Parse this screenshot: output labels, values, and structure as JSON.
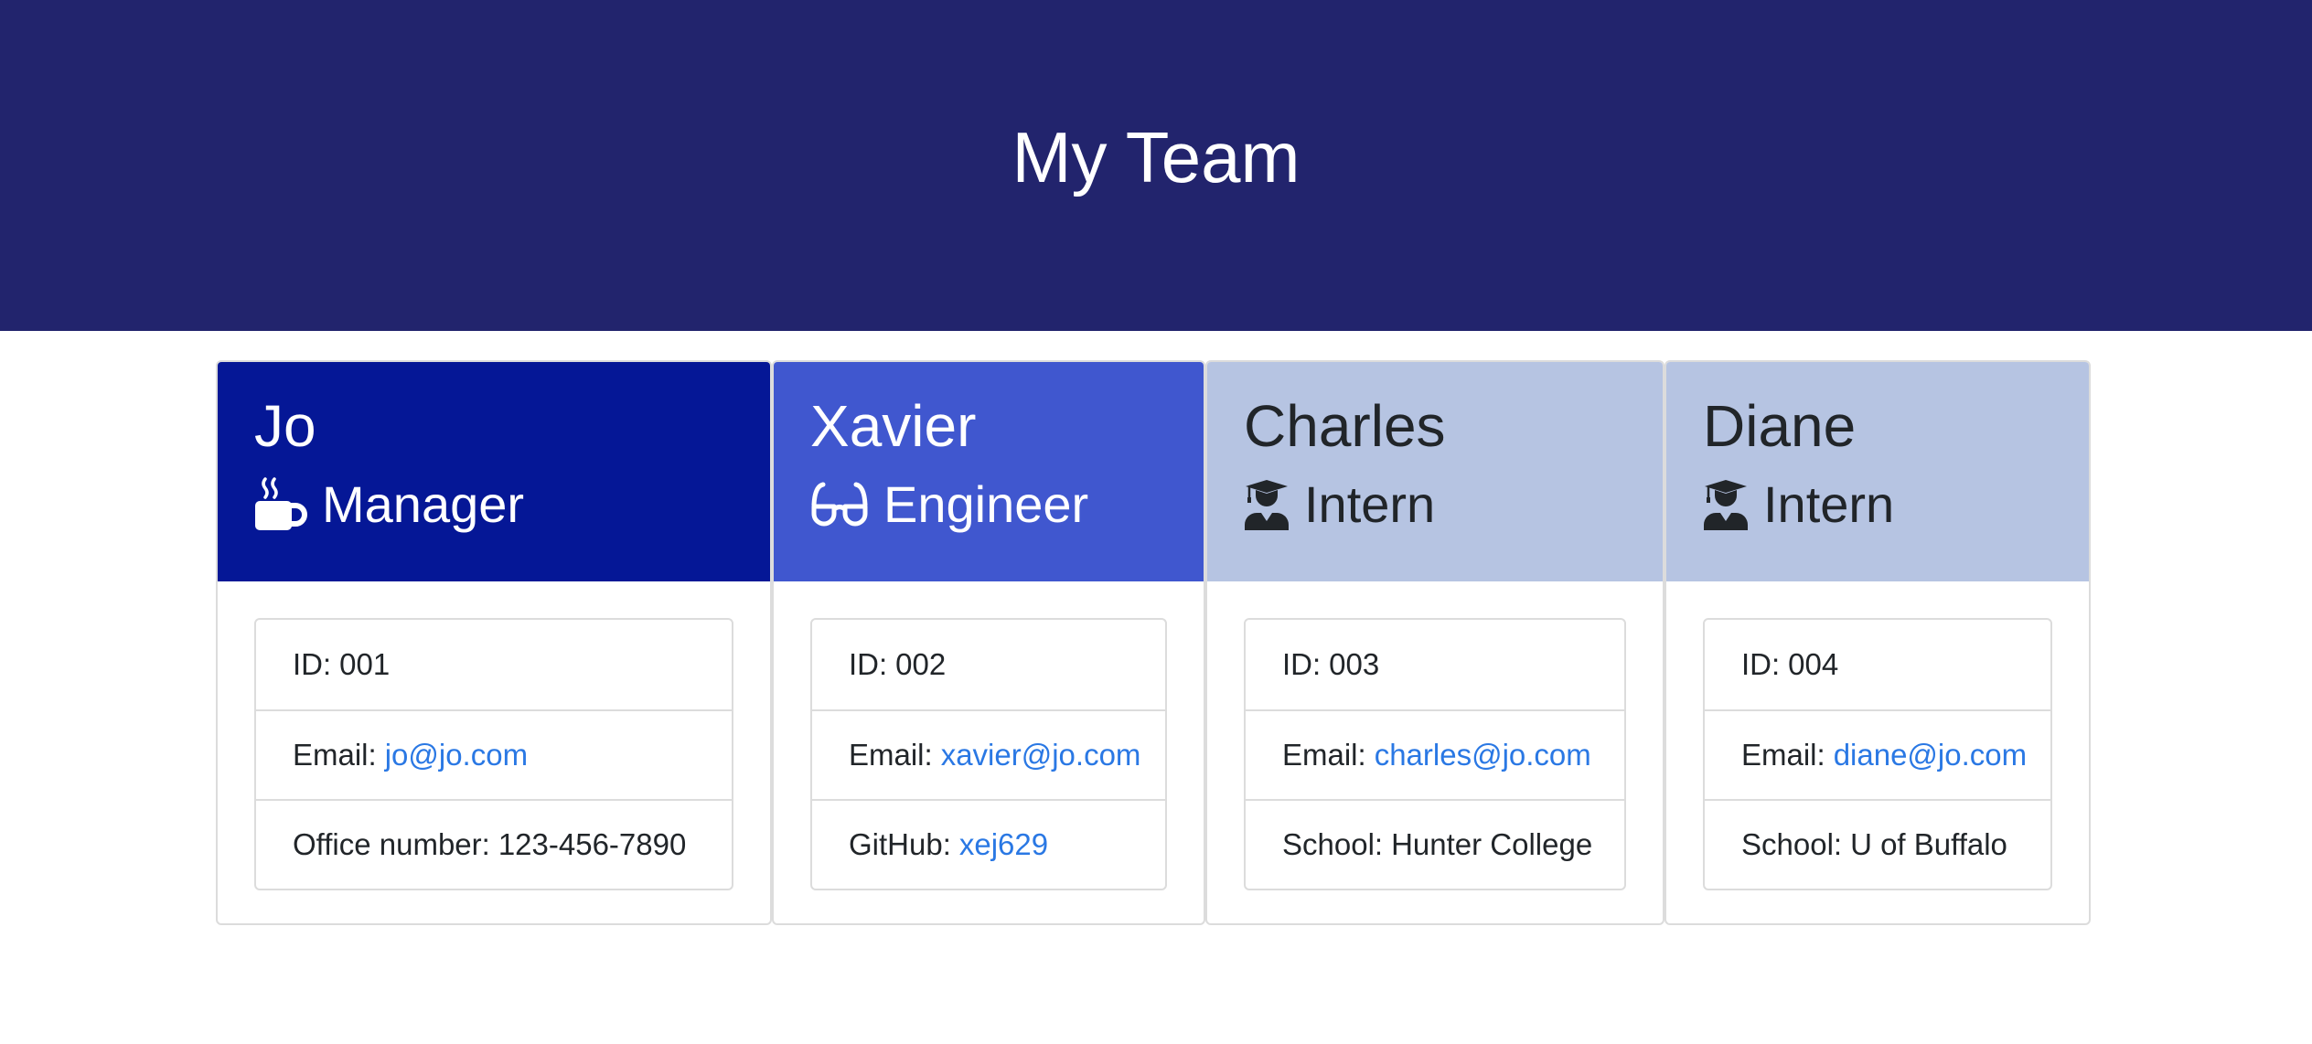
{
  "header": {
    "title": "My Team"
  },
  "colors": {
    "header_bg": "#22246d",
    "manager": "#051796",
    "engineer": "#4057cf",
    "intern": "#b6c4e2",
    "link": "#2a78e4"
  },
  "employees": [
    {
      "name": "Jo",
      "role": "Manager",
      "icon": "coffee-mug-icon",
      "id_label": "ID:",
      "id": "001",
      "email_label": "Email:",
      "email": "jo@jo.com",
      "extra_label": "Office number:",
      "extra": "123-456-7890"
    },
    {
      "name": "Xavier",
      "role": "Engineer",
      "icon": "glasses-icon",
      "id_label": "ID:",
      "id": "002",
      "email_label": "Email:",
      "email": "xavier@jo.com",
      "extra_label": "GitHub:",
      "extra": "xej629"
    },
    {
      "name": "Charles",
      "role": "Intern",
      "icon": "graduate-icon",
      "id_label": "ID:",
      "id": "003",
      "email_label": "Email:",
      "email": "charles@jo.com",
      "extra_label": "School:",
      "extra": "Hunter College"
    },
    {
      "name": "Diane",
      "role": "Intern",
      "icon": "graduate-icon",
      "id_label": "ID:",
      "id": "004",
      "email_label": "Email:",
      "email": "diane@jo.com",
      "extra_label": "School:",
      "extra": "U of Buffalo"
    }
  ]
}
